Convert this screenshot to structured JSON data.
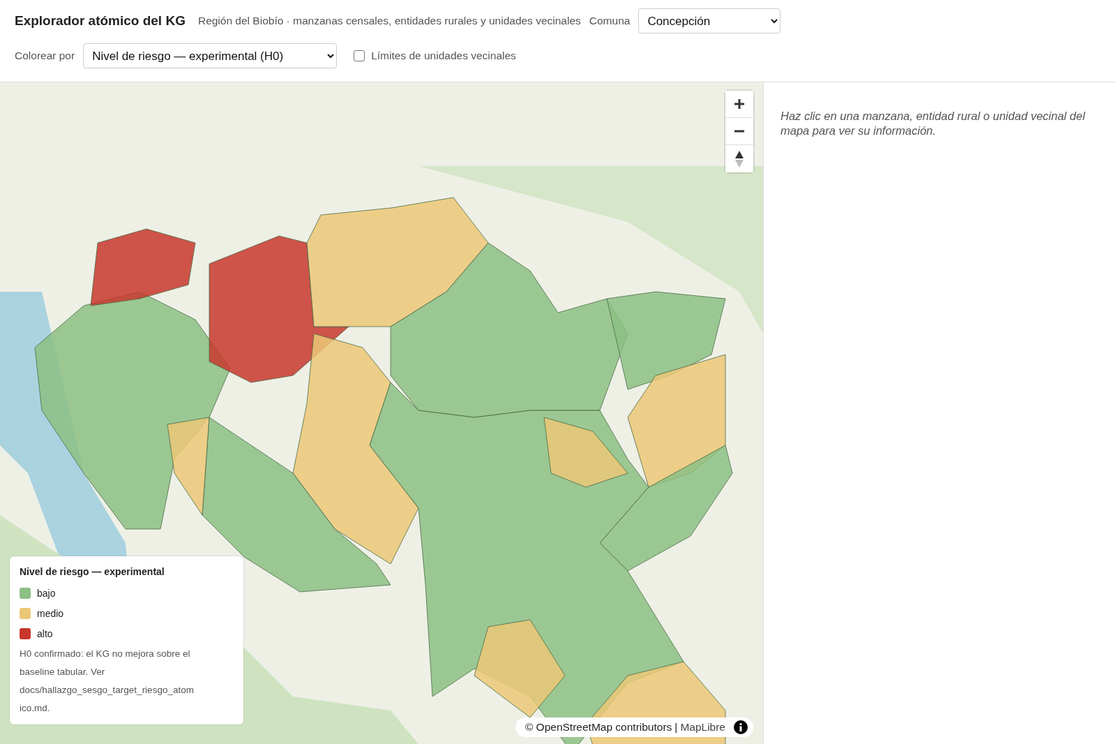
{
  "header": {
    "title": "Explorador atómico del KG",
    "subtitle": "Región del Biobío · manzanas censales, entidades rurales y unidades vecinales",
    "comuna_label": "Comuna",
    "comuna_value": "Concepción"
  },
  "toolbar": {
    "color_label": "Colorear por",
    "color_value": "Nivel de riesgo — experimental (H0)",
    "boundaries": {
      "label": "Límites de unidades vecinales",
      "checked": false
    }
  },
  "legend": {
    "title": "Nivel de riesgo — experimental",
    "items": [
      {
        "label": "bajo",
        "color": "#8cc084"
      },
      {
        "label": "medio",
        "color": "#ebc877"
      },
      {
        "label": "alto",
        "color": "#c8372d"
      }
    ],
    "note": "H0 confirmado: el KG no mejora sobre el baseline tabular. Ver docs/hallazgo_sesgo_target_riesgo_atomico.md."
  },
  "attribution": {
    "text": "© OpenStreetMap contributors",
    "separator": "|",
    "link": "MapLibre"
  },
  "panel": {
    "hint": "Haz clic en una manzana, entidad rural o unidad vecinal del mapa para ver su información."
  }
}
